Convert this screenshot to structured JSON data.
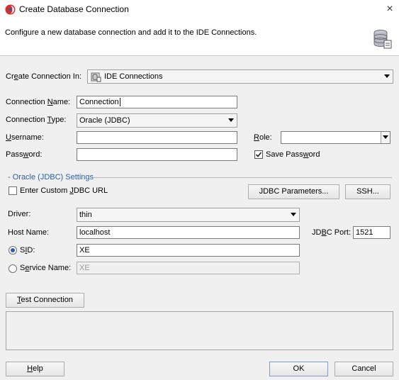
{
  "window": {
    "title": "Create Database Connection",
    "description": "Configure a new database connection and add it to the IDE Connections.",
    "close_symbol": "×"
  },
  "create_in": {
    "label_pre": "Cr",
    "label_u": "e",
    "label_post": "ate Connection In:",
    "value": "IDE Connections"
  },
  "connection_name": {
    "label_pre": "Connection ",
    "label_u": "N",
    "label_post": "ame:",
    "value": "Connection"
  },
  "connection_type": {
    "label_pre": "Connection ",
    "label_u": "T",
    "label_post": "ype:",
    "value": "Oracle (JDBC)"
  },
  "username": {
    "label_u": "U",
    "label_post": "sername:",
    "value": ""
  },
  "role": {
    "label_u": "R",
    "label_post": "ole:",
    "value": ""
  },
  "password": {
    "label_pre": "Pass",
    "label_u": "w",
    "label_post": "ord:",
    "value": ""
  },
  "save_password": {
    "label_pre": "Save Pass",
    "label_u": "w",
    "label_post": "ord",
    "checked": true
  },
  "oracle_section": {
    "title": "- Oracle (JDBC) Settings",
    "custom_jdbc_pre": "Enter Custom ",
    "custom_jdbc_u": "J",
    "custom_jdbc_post": "DBC URL",
    "custom_jdbc_checked": false,
    "jdbc_params_button": "JDBC Parameters...",
    "ssh_button": "SSH...",
    "driver_label": "Driver:",
    "driver_value": "thin",
    "host_label": "Host Name:",
    "host_value": "localhost",
    "port_label_pre": "JD",
    "port_label_u": "B",
    "port_label_post": "C Port:",
    "port_value": "1521",
    "sid_label_pre": "S",
    "sid_label_u": "I",
    "sid_label_post": "D:",
    "sid_value": "XE",
    "service_label_pre": "S",
    "service_label_u": "e",
    "service_label_post": "rvice Name:",
    "service_value": "XE",
    "selected": "sid"
  },
  "test_button": {
    "label_u": "T",
    "label_post": "est Connection"
  },
  "footer": {
    "help_u": "H",
    "help_post": "elp",
    "ok": "OK",
    "cancel": "Cancel"
  },
  "colors": {
    "accent": "#2b5ea8",
    "background": "#f0f0f0"
  }
}
